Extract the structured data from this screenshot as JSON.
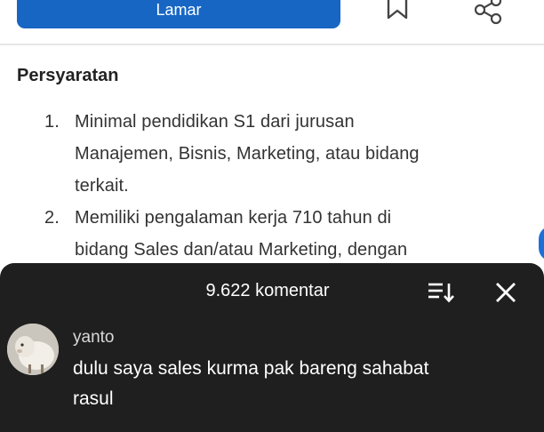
{
  "header": {
    "apply_label": "Lamar",
    "colors": {
      "primary": "#1766c4"
    },
    "icons": [
      "bookmark-icon",
      "share-icon"
    ]
  },
  "requirements": {
    "title": "Persyaratan",
    "items": [
      {
        "number": "1.",
        "lines": [
          "Minimal pendidikan S1 dari jurusan",
          "Manajemen, Bisnis, Marketing, atau bidang",
          "terkait."
        ]
      },
      {
        "number": "2.",
        "lines": [
          "Memiliki pengalaman kerja 710 tahun di",
          "bidang Sales dan/atau Marketing, dengan"
        ]
      }
    ]
  },
  "comments": {
    "count_label": "9.622 komentar",
    "icons": [
      "sort-icon",
      "close-icon",
      "avatar"
    ],
    "items": [
      {
        "user": "yanto",
        "text_lines": [
          "dulu saya sales kurma pak bareng sahabat",
          "rasul"
        ]
      }
    ]
  }
}
